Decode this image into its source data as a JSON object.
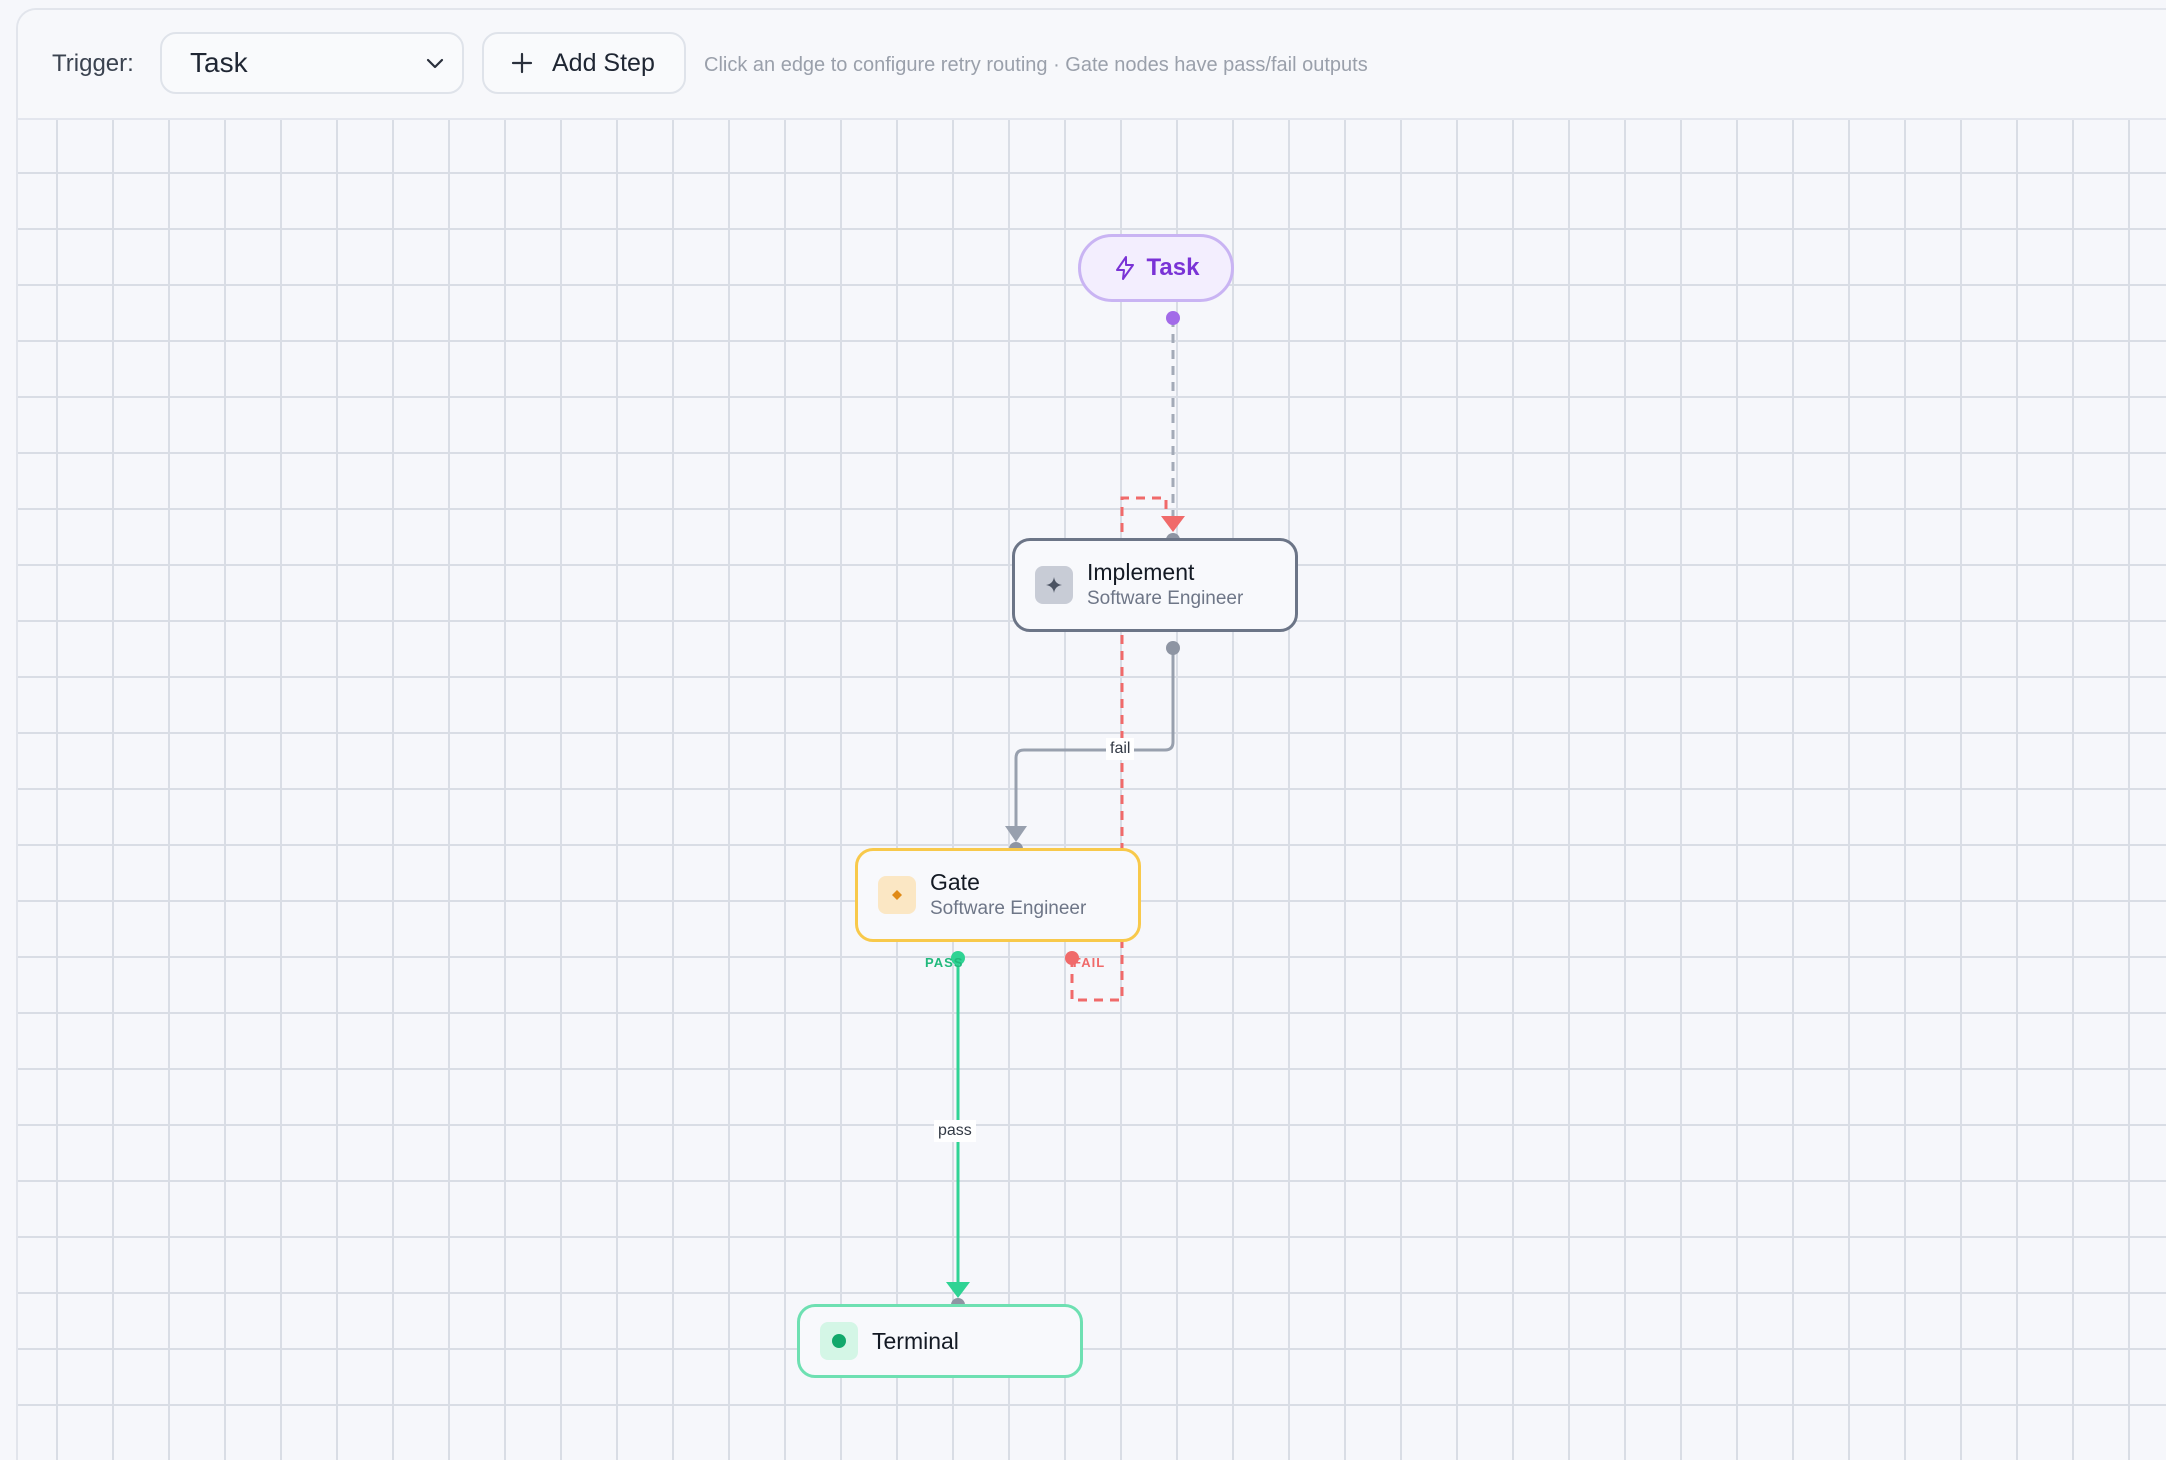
{
  "toolbar": {
    "trigger_label": "Trigger:",
    "trigger_value": "Task",
    "add_step_label": "Add Step",
    "hint": "Click an edge to configure retry routing · Gate nodes have pass/fail outputs"
  },
  "nodes": {
    "task": {
      "title": "Task"
    },
    "implement": {
      "title": "Implement",
      "subtitle": "Software Engineer"
    },
    "gate": {
      "title": "Gate",
      "subtitle": "Software Engineer",
      "pass_port": "PASS",
      "fail_port": "FAIL"
    },
    "terminal": {
      "title": "Terminal"
    }
  },
  "edges": {
    "implement_to_gate_label": "fail",
    "gate_pass_label": "pass"
  },
  "colors": {
    "trigger_accent": "#7a33d6",
    "gate_border": "#f8c94b",
    "terminal_border": "#6ee0b2",
    "pass_green": "#2fd394",
    "fail_red": "#f06a6a",
    "edge_gray": "#98a0ae"
  },
  "icons": {
    "trigger": "lightning-bolt-icon",
    "implement": "sparkle-icon",
    "gate": "diamond-icon",
    "terminal": "dot-icon",
    "add": "plus-icon",
    "select": "chevron-down-icon"
  }
}
